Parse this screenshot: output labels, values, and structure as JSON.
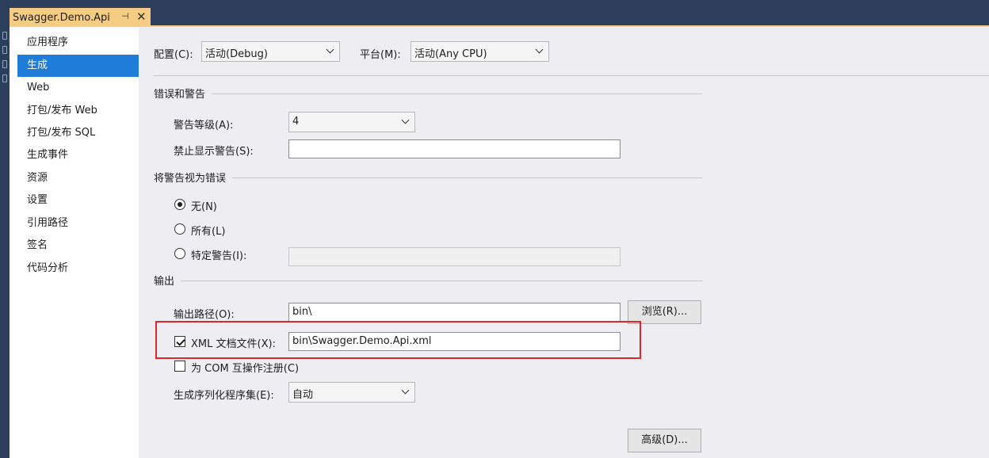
{
  "tab": {
    "title": "Swagger.Demo.Api",
    "pin_icon": "pin-icon",
    "close_icon": "close-icon",
    "accent_color": "#f5cc84"
  },
  "sidebar": {
    "items": [
      {
        "label": "应用程序",
        "active": false
      },
      {
        "label": "生成",
        "active": true
      },
      {
        "label": "Web",
        "active": false
      },
      {
        "label": "打包/发布 Web",
        "active": false
      },
      {
        "label": "打包/发布 SQL",
        "active": false
      },
      {
        "label": "生成事件",
        "active": false
      },
      {
        "label": "资源",
        "active": false
      },
      {
        "label": "设置",
        "active": false
      },
      {
        "label": "引用路径",
        "active": false
      },
      {
        "label": "签名",
        "active": false
      },
      {
        "label": "代码分析",
        "active": false
      }
    ],
    "active_color": "#1f7dd8"
  },
  "config": {
    "config_label": "配置(C):",
    "config_value": "活动(Debug)",
    "platform_label": "平台(M):",
    "platform_value": "活动(Any CPU)"
  },
  "errors_warnings": {
    "title": "错误和警告",
    "warning_level_label": "警告等级(A):",
    "warning_level_value": "4",
    "suppress_label": "禁止显示警告(S):",
    "suppress_value": ""
  },
  "treat_warnings": {
    "title": "将警告视为错误",
    "options": [
      {
        "label": "无(N)",
        "checked": true
      },
      {
        "label": "所有(L)",
        "checked": false
      },
      {
        "label": "特定警告(I):",
        "checked": false
      }
    ],
    "specific_value": ""
  },
  "output": {
    "title": "输出",
    "path_label": "输出路径(O):",
    "path_value": "bin\\",
    "browse_label": "浏览(R)...",
    "xml_label": "XML 文档文件(X):",
    "xml_checked": true,
    "xml_value": "bin\\Swagger.Demo.Api.xml",
    "com_label": "为 COM 互操作注册(C)",
    "com_checked": false,
    "serialization_label": "生成序列化程序集(E):",
    "serialization_value": "自动",
    "advanced_label": "高级(D)...",
    "highlight_color": "#e0262b"
  }
}
